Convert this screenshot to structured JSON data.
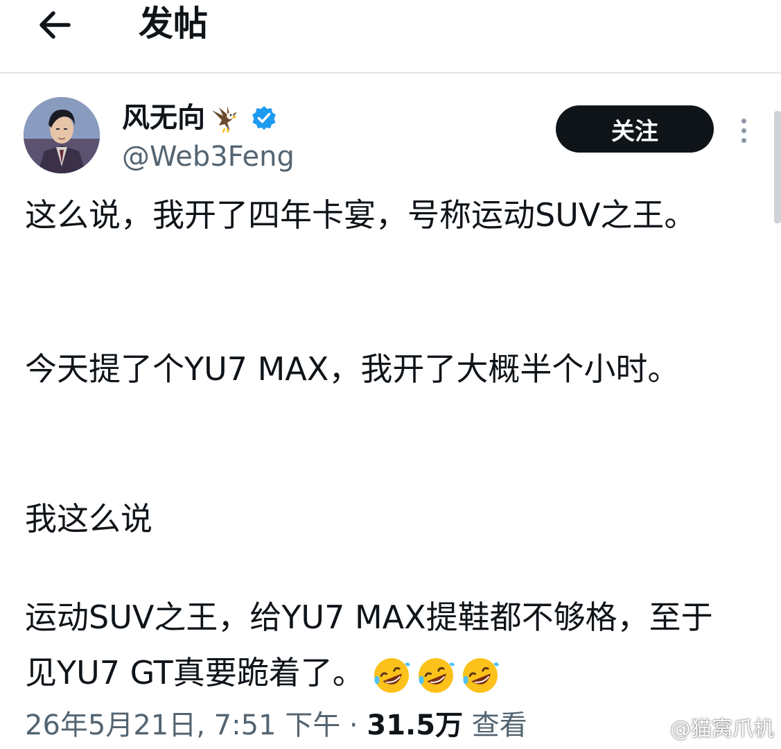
{
  "header": {
    "title": "发帖",
    "back_icon": "arrow-left-icon"
  },
  "author": {
    "display_name": "风无向",
    "handle": "@Web3Feng",
    "verified": true,
    "verified_color": "#1d9bf0",
    "follow_label": "关注"
  },
  "tweet": {
    "paragraphs": [
      "这么说，我开了四年卡宴，号称运动SUV之王。",
      "今天提了个YU7 MAX，我开了大概半个小时。",
      "我这么说",
      "运动SUV之王，给YU7 MAX提鞋都不够格，至于见YU7 GT真要跪着了。"
    ],
    "emoji": [
      "rolling-on-floor-laughing-emoji",
      "rolling-on-floor-laughing-emoji",
      "rolling-on-floor-laughing-emoji"
    ]
  },
  "meta": {
    "timestamp": "26年5月21日, 7:51 下午",
    "separator": " · ",
    "views_count": "31.5万",
    "views_label": " 查看"
  },
  "watermark": {
    "text": "@猫窝爪机"
  },
  "colors": {
    "text": "#0f1419",
    "secondary_text": "#536471",
    "follow_bg": "#0f1419",
    "follow_text": "#ffffff"
  }
}
